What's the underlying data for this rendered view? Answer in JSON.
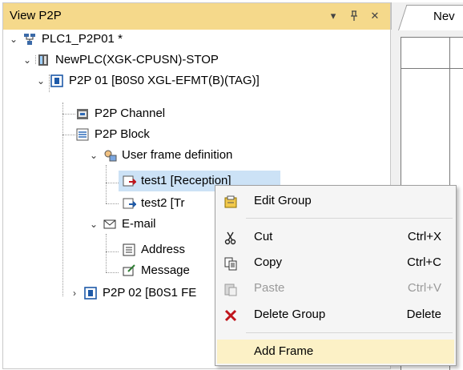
{
  "panel": {
    "title": "View P2P",
    "dropdown_glyph": "▾",
    "pin_glyph": "ꟸ",
    "close_glyph": "✕"
  },
  "right_tab": {
    "label": "Nev"
  },
  "tree": {
    "root": "PLC1_P2P01 *",
    "plc": "NewPLC(XGK-CPUSN)-STOP",
    "p2p01": "P2P 01 [B0S0 XGL-EFMT(B)(TAG)]",
    "channel": "P2P Channel",
    "block": "P2P Block",
    "user_frame": "User frame definition",
    "test1": "test1 [Reception]",
    "test2": "test2 [Tr",
    "email": "E-mail",
    "address": "Address",
    "message": "Message",
    "p2p02": "P2P 02 [B0S1 FE"
  },
  "context_menu": {
    "edit_group": "Edit Group",
    "cut": "Cut",
    "cut_shortcut": "Ctrl+X",
    "copy": "Copy",
    "copy_shortcut": "Ctrl+C",
    "paste": "Paste",
    "paste_shortcut": "Ctrl+V",
    "delete_group": "Delete Group",
    "delete_shortcut": "Delete",
    "add_frame": "Add Frame"
  },
  "icons": {
    "root": "network-project-icon",
    "plc": "plc-cpu-icon",
    "p2p": "p2p-module-icon",
    "channel": "channel-icon",
    "block": "block-list-icon",
    "user_frame": "user-frame-icon",
    "frame_reception": "frame-reception-icon",
    "frame_transmission": "frame-transmission-icon",
    "email": "email-icon",
    "address": "address-book-icon",
    "message": "message-icon",
    "edit_group": "edit-group-icon",
    "cut": "scissors-icon",
    "copy": "copy-icon",
    "paste": "paste-icon",
    "delete": "delete-x-icon"
  },
  "colors": {
    "title_bar": "#f5d98b",
    "selection": "#cce2f6",
    "menu_hover": "#fcf1c6",
    "delete_red": "#c0141b"
  }
}
